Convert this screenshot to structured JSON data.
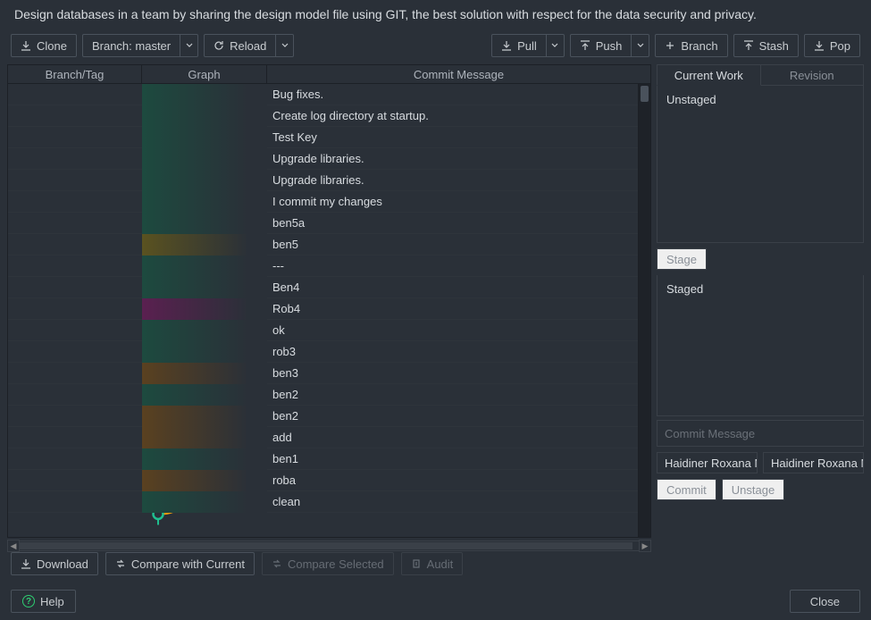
{
  "banner": "Design databases in a team by sharing the design model file using GIT, the best solution with respect for the data security and privacy.",
  "toolbar": {
    "clone": "Clone",
    "branch_selector": "Branch: master",
    "reload": "Reload",
    "pull": "Pull",
    "push": "Push",
    "branch": "Branch",
    "stash": "Stash",
    "pop": "Pop"
  },
  "columns": {
    "branch_tag": "Branch/Tag",
    "graph": "Graph",
    "commit_message": "Commit Message"
  },
  "commits": [
    {
      "msg": "Bug fixes.",
      "lane0": "ring-teal",
      "row_grad": "grad-teal"
    },
    {
      "msg": "Create log directory at startup.",
      "lane0": "ring-teal",
      "row_grad": "grad-teal"
    },
    {
      "msg": "Test Key",
      "lane0": "ring-teal",
      "row_grad": "grad-teal"
    },
    {
      "msg": "Upgrade libraries.",
      "lane0": "ring-teal",
      "row_grad": "grad-teal"
    },
    {
      "msg": "Upgrade libraries.",
      "lane0": "ring-teal",
      "row_grad": "grad-teal"
    },
    {
      "msg": "I commit my changes",
      "lane0": "dot-teal",
      "row_grad": "grad-teal"
    },
    {
      "msg": "ben5a",
      "lane0": "ring-teal",
      "lane1": "",
      "row_grad": "grad-teal"
    },
    {
      "msg": "ben5",
      "lane0": "",
      "lane1": "ring-yellow",
      "row_grad": "grad-yellow"
    },
    {
      "msg": "---",
      "lane0": "dot-teal",
      "row_grad": "grad-teal"
    },
    {
      "msg": "Ben4",
      "lane0": "ring-teal",
      "lane1": "",
      "row_grad": "grad-teal"
    },
    {
      "msg": "Rob4",
      "lane0": "",
      "lane1": "ring-magenta",
      "row_grad": "grad-magenta"
    },
    {
      "msg": "ok",
      "lane0": "dot-teal",
      "row_grad": "grad-teal"
    },
    {
      "msg": "rob3",
      "lane0": "dot-teal",
      "row_grad": "grad-teal"
    },
    {
      "msg": "ben3",
      "lane0": "",
      "lane1": "ring-orange",
      "row_grad": "grad-orange"
    },
    {
      "msg": "ben2",
      "lane0": "ring-teal",
      "lane1": "",
      "row_grad": "grad-teal"
    },
    {
      "msg": "ben2",
      "lane0": "",
      "lane1": "ring-orange",
      "row_grad": "grad-orange"
    },
    {
      "msg": "add",
      "lane0": "",
      "lane1": "dot-orange",
      "row_grad": "grad-orange"
    },
    {
      "msg": "ben1",
      "lane0": "ring-teal",
      "lane1": "",
      "row_grad": "grad-teal"
    },
    {
      "msg": "roba",
      "lane0": "",
      "lane1": "ring-orange",
      "row_grad": "grad-orange"
    },
    {
      "msg": "clean",
      "lane0": "ring-teal",
      "lane1": "",
      "row_grad": "grad-teal"
    }
  ],
  "right_panel": {
    "tab_current": "Current Work",
    "tab_revision": "Revision",
    "unstaged": "Unstaged",
    "stage_btn": "Stage",
    "staged": "Staged",
    "commit_msg_placeholder": "Commit Message",
    "author1": "Haidiner Roxana M",
    "author2": "Haidiner Roxana M",
    "commit_btn": "Commit",
    "unstage_btn": "Unstage"
  },
  "bottombar": {
    "download": "Download",
    "compare_current": "Compare with Current",
    "compare_selected": "Compare Selected",
    "audit": "Audit"
  },
  "footer": {
    "help": "Help",
    "close": "Close"
  },
  "colors": {
    "teal": "#1fbf8f",
    "orange": "#f59e0b",
    "yellow": "#e8d23a",
    "magenta": "#d63cd6",
    "cyan": "#2bb9d9"
  }
}
